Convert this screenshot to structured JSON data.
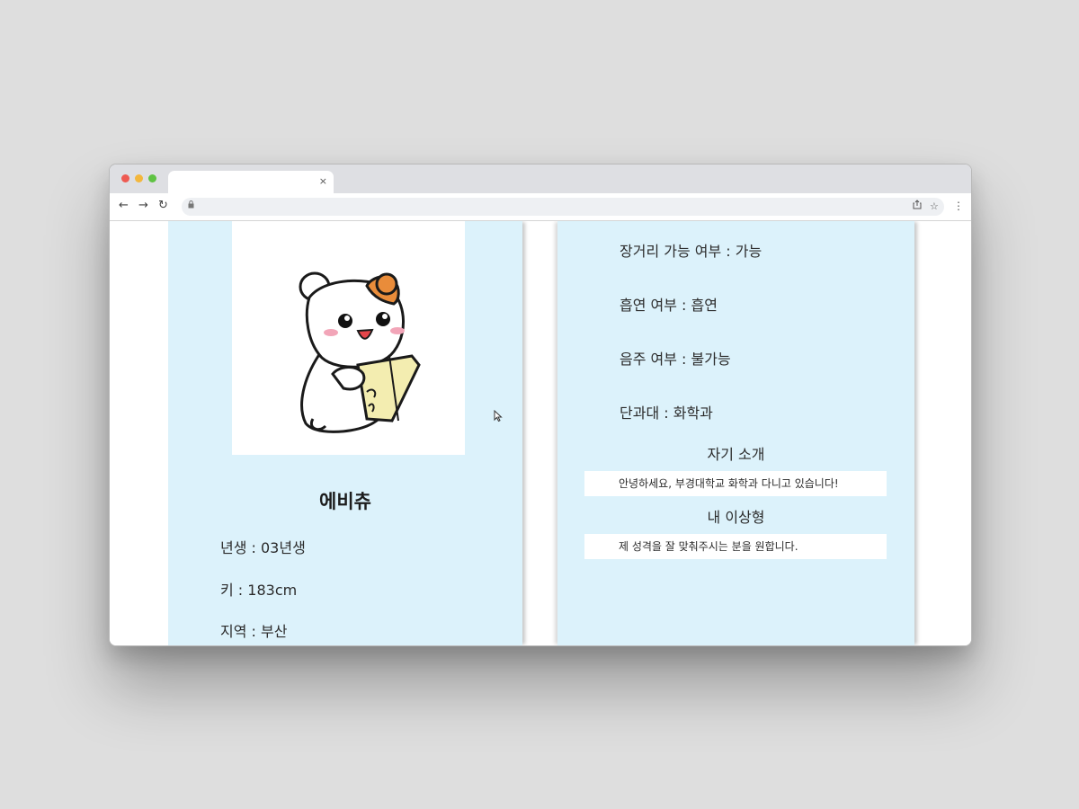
{
  "browser": {
    "tab_close": "×",
    "nav_back": "←",
    "nav_forward": "→",
    "nav_reload": "↻",
    "address_lock": "🔒",
    "share": "⇪",
    "bookmark": "☆",
    "menu": "⋮"
  },
  "profile": {
    "name": "에비츄",
    "birth_year": "년생 : 03년생",
    "height": "키 : 183cm",
    "region": "지역 : 부산"
  },
  "details": {
    "long_distance": "장거리 가능 여부 : 가능",
    "smoking": "흡연 여부 : 흡연",
    "drinking": "음주 여부 : 불가능",
    "college": "단과대 : 화학과"
  },
  "intro": {
    "title": "자기 소개",
    "text": "안녕하세요, 부경대학교 화학과 다니고 있습니다!"
  },
  "ideal": {
    "title": "내 이상형",
    "text": "제 성격을 잘 맞춰주시는 분을 원합니다."
  },
  "colors": {
    "page_bg": "#dedede",
    "panel_bg": "#dcf2fb",
    "hamster_orange": "#e98c3a",
    "hamster_blush": "#f2a5b8",
    "cracker": "#f3edb0"
  }
}
